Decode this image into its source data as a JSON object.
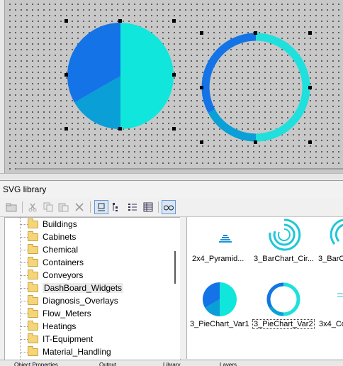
{
  "canvas": {
    "pie_chart": {
      "type": "pie",
      "colors": [
        "#11e6dc",
        "#0a9fd6",
        "#1473e6"
      ]
    },
    "ring_chart": {
      "type": "donut",
      "colors": [
        "#1fe0dc",
        "#0a9fd6",
        "#1473e6"
      ]
    }
  },
  "library": {
    "title": "SVG library",
    "toolbar": {
      "buttons": [
        "folder-up-icon",
        "cut-icon",
        "copy-icon",
        "paste-icon",
        "delete-icon",
        "large-icons-view-icon",
        "tree-view-icon",
        "list-view-icon",
        "details-view-icon",
        "preview-icon"
      ]
    },
    "tree": {
      "items": [
        {
          "label": "Buildings"
        },
        {
          "label": "Cabinets"
        },
        {
          "label": "Chemical"
        },
        {
          "label": "Containers"
        },
        {
          "label": "Conveyors"
        },
        {
          "label": "DashBoard_Widgets"
        },
        {
          "label": "Diagnosis_Overlays"
        },
        {
          "label": "Flow_Meters"
        },
        {
          "label": "Heatings"
        },
        {
          "label": "IT-Equipment"
        },
        {
          "label": "Material_Handling"
        }
      ]
    },
    "thumbnails": [
      {
        "label": "2x4_Pyramid..."
      },
      {
        "label": "3_BarChart_Cir..."
      },
      {
        "label": "3_BarC"
      },
      {
        "label": "3_PieChart_Var1"
      },
      {
        "label": "3_PieChart_Var2"
      },
      {
        "label": "3x4_Co"
      }
    ]
  },
  "statusbar": {
    "items": [
      "Object Properties",
      "Output",
      "Library",
      "Layers"
    ]
  }
}
